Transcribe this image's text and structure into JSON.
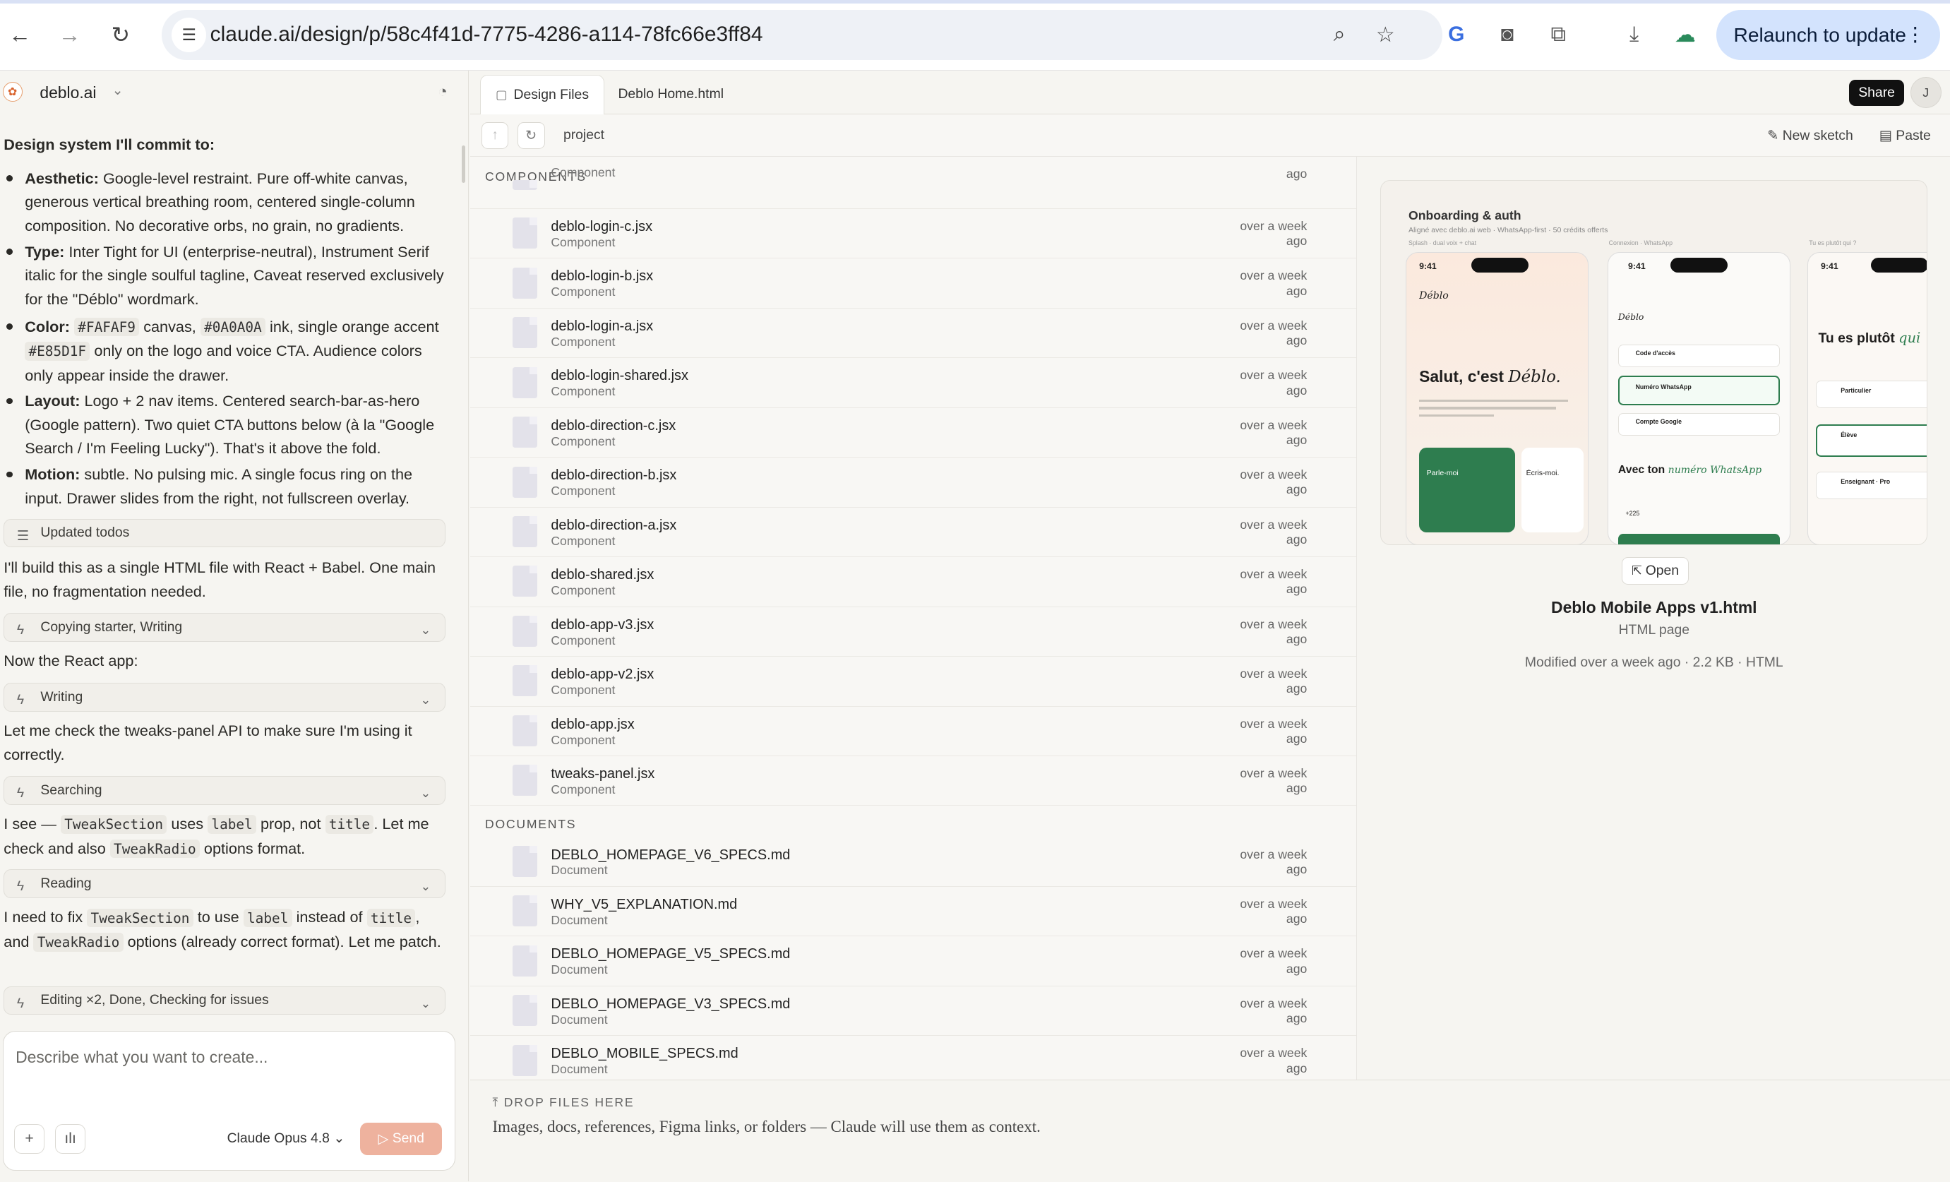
{
  "browser": {
    "url": "claude.ai/design/p/58c4f41d-7775-4286-a114-78fc66e3ff84",
    "relaunch_label": "Relaunch to update"
  },
  "project": {
    "name": "deblo.ai"
  },
  "chat": {
    "heading": "Design system I'll commit to:",
    "bullets": [
      {
        "label": "Aesthetic:",
        "text": " Google-level restraint. Pure off-white canvas, generous vertical breathing room, centered single-column composition. No decorative orbs, no grain, no gradients."
      },
      {
        "label": "Type:",
        "text": " Inter Tight for UI (enterprise-neutral), Instrument Serif italic for the single soulful tagline, Caveat reserved exclusively for the \"Déblo\" wordmark."
      },
      {
        "label": "Color:",
        "code1": "#FAFAF9",
        "t1": " canvas, ",
        "code2": "#0A0A0A",
        "t2": " ink, single orange accent ",
        "code3": "#E85D1F",
        "t3": " only on the logo and voice CTA. Audience colors only appear inside the drawer."
      },
      {
        "label": "Layout:",
        "text": " Logo + 2 nav items. Centered search-bar-as-hero (Google pattern). Two quiet CTA buttons below (à la \"Google Search / I'm Feeling Lucky\"). That's it above the fold."
      },
      {
        "label": "Motion:",
        "text": " subtle. No pulsing mic. A single focus ring on the input. Drawer slides from the right, not fullscreen overlay."
      }
    ],
    "tool_todos": "Updated todos",
    "msg1": "I'll build this as a single HTML file with React + Babel. One main file, no fragmentation needed.",
    "tool1": "Copying starter, Writing",
    "msg2": "Now the React app:",
    "tool2": "Writing",
    "msg3": "Let me check the tweaks-panel API to make sure I'm using it correctly.",
    "tool3": "Searching",
    "msg4": {
      "a": "I see — ",
      "c1": "TweakSection",
      "b": " uses ",
      "c2": "label",
      "c": " prop, not ",
      "c3": "title",
      "d": ". Let me check and also ",
      "c4": "TweakRadio",
      "e": " options format."
    },
    "tool4": "Reading",
    "msg5": {
      "a": "I need to fix ",
      "c1": "TweakSection",
      "b": " to use ",
      "c2": "label",
      "c": " instead of ",
      "c3": "title",
      "d": ", and ",
      "c4": "TweakRadio",
      "e": " options (already correct format). Let me patch."
    },
    "tool5": "Editing ×2, Done, Checking for issues"
  },
  "composer": {
    "placeholder": "Describe what you want to create...",
    "model": "Claude Opus 4.8",
    "send": "Send"
  },
  "tabs": {
    "design_files": "Design Files",
    "home": "Deblo Home.html",
    "share": "Share",
    "avatar": "J"
  },
  "pathbar": {
    "path": "project",
    "new_sketch": "New sketch",
    "paste": "Paste"
  },
  "sections": {
    "components": "COMPONENTS",
    "documents": "DOCUMENTS"
  },
  "top_partial": {
    "type": "Component",
    "date": "ago"
  },
  "components": [
    {
      "name": "deblo-login-c.jsx",
      "type": "Component",
      "date1": "over a week",
      "date2": "ago"
    },
    {
      "name": "deblo-login-b.jsx",
      "type": "Component",
      "date1": "over a week",
      "date2": "ago"
    },
    {
      "name": "deblo-login-a.jsx",
      "type": "Component",
      "date1": "over a week",
      "date2": "ago"
    },
    {
      "name": "deblo-login-shared.jsx",
      "type": "Component",
      "date1": "over a week",
      "date2": "ago"
    },
    {
      "name": "deblo-direction-c.jsx",
      "type": "Component",
      "date1": "over a week",
      "date2": "ago"
    },
    {
      "name": "deblo-direction-b.jsx",
      "type": "Component",
      "date1": "over a week",
      "date2": "ago"
    },
    {
      "name": "deblo-direction-a.jsx",
      "type": "Component",
      "date1": "over a week",
      "date2": "ago"
    },
    {
      "name": "deblo-shared.jsx",
      "type": "Component",
      "date1": "over a week",
      "date2": "ago"
    },
    {
      "name": "deblo-app-v3.jsx",
      "type": "Component",
      "date1": "over a week",
      "date2": "ago"
    },
    {
      "name": "deblo-app-v2.jsx",
      "type": "Component",
      "date1": "over a week",
      "date2": "ago"
    },
    {
      "name": "deblo-app.jsx",
      "type": "Component",
      "date1": "over a week",
      "date2": "ago"
    },
    {
      "name": "tweaks-panel.jsx",
      "type": "Component",
      "date1": "over a week",
      "date2": "ago"
    }
  ],
  "documents": [
    {
      "name": "DEBLO_HOMEPAGE_V6_SPECS.md",
      "type": "Document",
      "date1": "over a week",
      "date2": "ago"
    },
    {
      "name": "WHY_V5_EXPLANATION.md",
      "type": "Document",
      "date1": "over a week",
      "date2": "ago"
    },
    {
      "name": "DEBLO_HOMEPAGE_V5_SPECS.md",
      "type": "Document",
      "date1": "over a week",
      "date2": "ago"
    },
    {
      "name": "DEBLO_HOMEPAGE_V3_SPECS.md",
      "type": "Document",
      "date1": "over a week",
      "date2": "ago"
    },
    {
      "name": "DEBLO_MOBILE_SPECS.md",
      "type": "Document",
      "date1": "over a week",
      "date2": "ago"
    }
  ],
  "dropzone": {
    "title": "DROP FILES HERE",
    "text": "Images, docs, references, Figma links, or folders — Claude will use them as context."
  },
  "preview": {
    "thumb": {
      "title": "Onboarding & auth",
      "subtitle": "Aligné avec deblo.ai web · WhatsApp-first · 50 crédits offerts",
      "col1": "Splash · dual voix + chat",
      "col2": "Connexion · WhatsApp",
      "col3": "Tu es plutôt qui ?",
      "time": "9:41",
      "brand": "Déblo",
      "hello": "Salut, c'est",
      "hello_brand": "Déblo.",
      "login_title": "Avec ton",
      "login_brand": "numéro WhatsApp",
      "who": "Tu es plutôt",
      "who_em": "qui",
      "opt1": "Particulier",
      "opt2": "Élève",
      "opt3": "Enseignant · Pro",
      "talk": "Parle-moi",
      "write": "Écris-moi.",
      "code": "Code d'accès",
      "wa": "Numéro WhatsApp",
      "google": "Compte Google",
      "prefix": "+225"
    },
    "open": "Open",
    "name": "Deblo Mobile Apps v1.html",
    "type": "HTML page",
    "meta": "Modified over a week ago · 2.2 KB · HTML"
  },
  "colors": {
    "accent": "#E85D1F",
    "send": "#EEB29E",
    "whatsapp": "#2E7D4F"
  }
}
